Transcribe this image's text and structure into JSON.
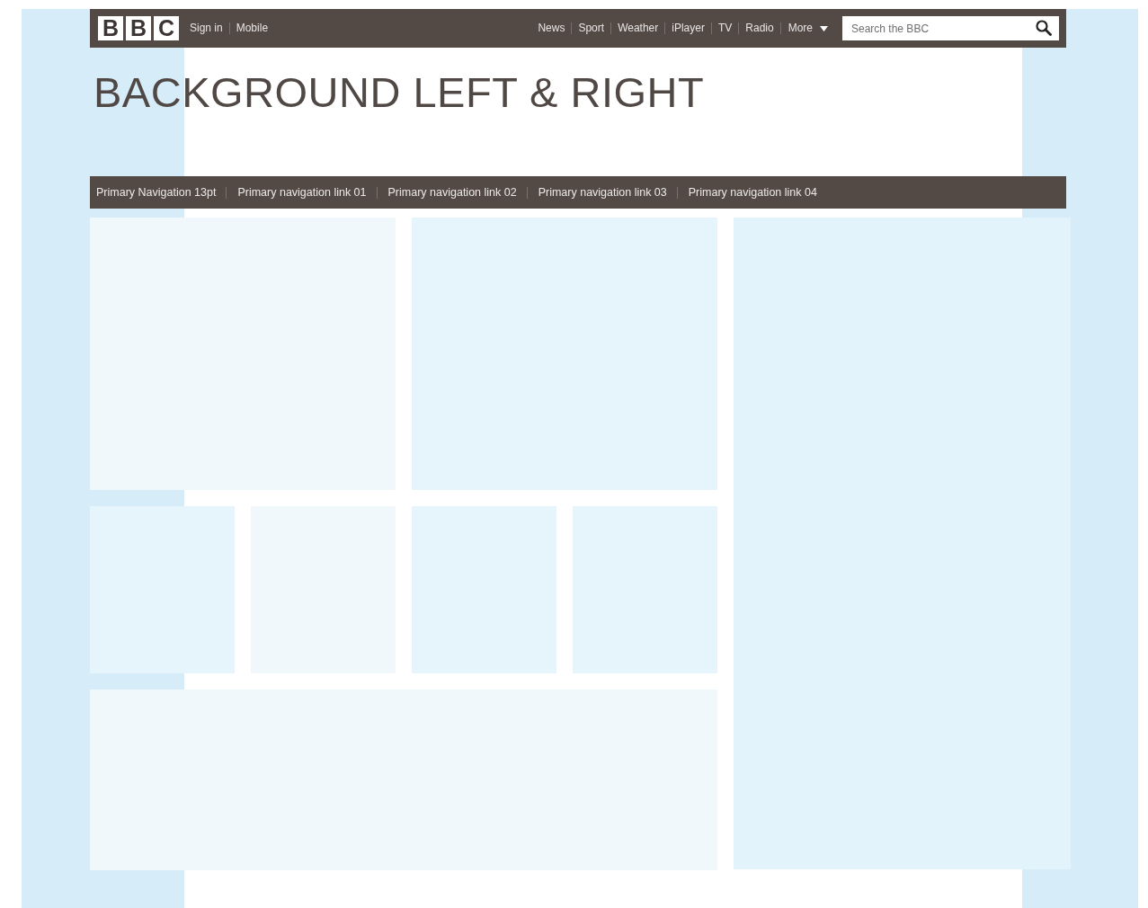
{
  "header": {
    "logo": [
      "B",
      "B",
      "C"
    ],
    "account_links": [
      "Sign in",
      "Mobile"
    ],
    "nav_links": [
      "News",
      "Sport",
      "Weather",
      "iPlayer",
      "TV",
      "Radio"
    ],
    "more_menu": {
      "label": "More",
      "expanded": false
    },
    "search": {
      "placeholder": "Search the BBC"
    }
  },
  "page_title": "BACKGROUND LEFT & RIGHT",
  "primary_navigation": [
    "Primary Navigation 13pt",
    "Primary navigation link 01",
    "Primary navigation link 02",
    "Primary navigation link 03",
    "Primary navigation link 04"
  ]
}
